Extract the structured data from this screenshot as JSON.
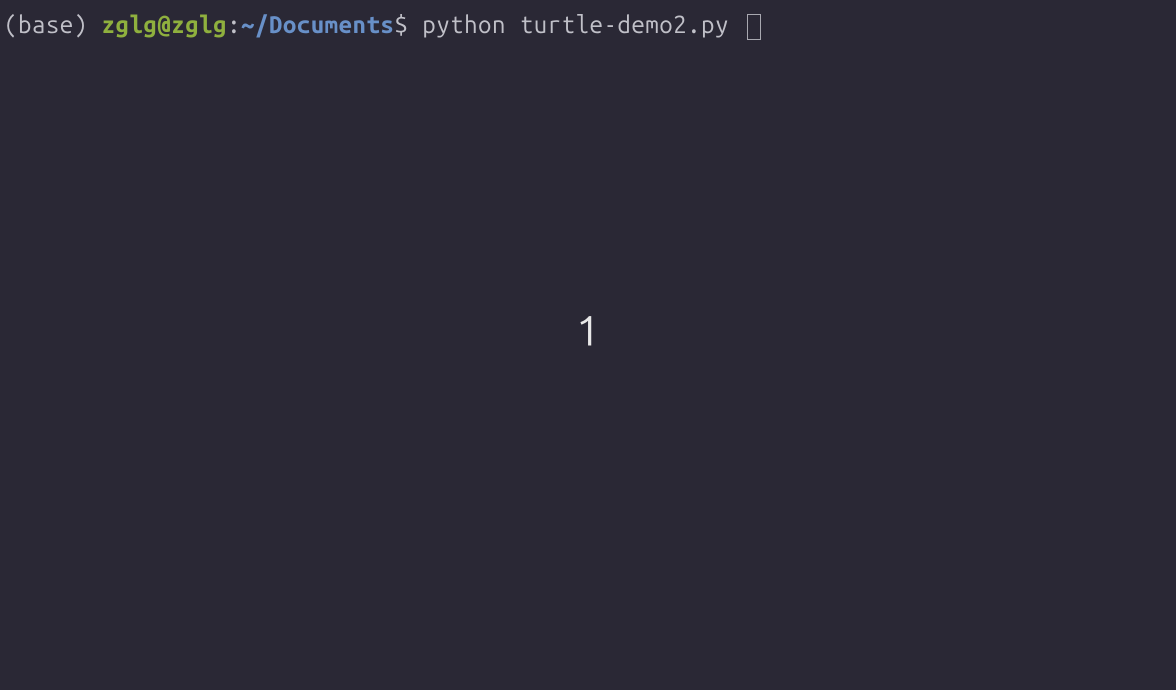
{
  "prompt": {
    "env": "(base) ",
    "user_host": "zglg@zglg",
    "colon": ":",
    "path": "~/Documents",
    "dollar": "$ ",
    "command": "python turtle-demo2.py "
  },
  "center_value": "1"
}
